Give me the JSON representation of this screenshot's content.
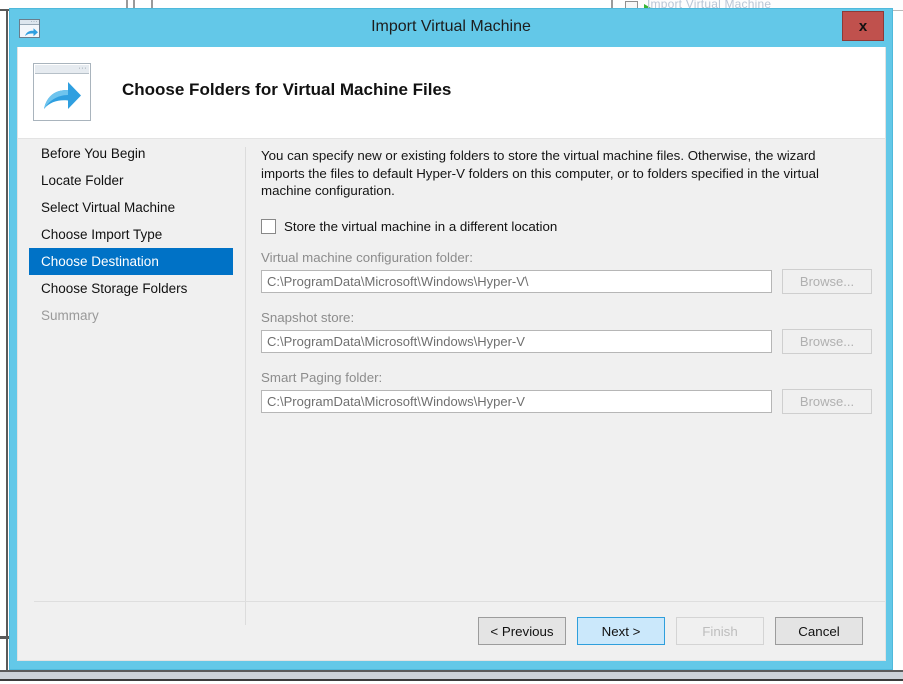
{
  "background": {
    "menu_item_label": "Import Virtual Machine",
    "menu_icon": "green-arrow-icon"
  },
  "window": {
    "title": "Import Virtual Machine",
    "title_icon": "import-vm-icon",
    "close_label": "x",
    "titlebar_color": "#63c8e8",
    "close_color": "#c0514d"
  },
  "header": {
    "icon": "window-arrow-icon",
    "title": "Choose Folders for Virtual Machine Files"
  },
  "nav": {
    "items": [
      {
        "label": "Before You Begin",
        "state": "normal"
      },
      {
        "label": "Locate Folder",
        "state": "normal"
      },
      {
        "label": "Select Virtual Machine",
        "state": "normal"
      },
      {
        "label": "Choose Import Type",
        "state": "normal"
      },
      {
        "label": "Choose Destination",
        "state": "selected"
      },
      {
        "label": "Choose Storage Folders",
        "state": "normal"
      },
      {
        "label": "Summary",
        "state": "disabled"
      }
    ],
    "selected_color": "#0072c6"
  },
  "content": {
    "intro": "You can specify new or existing folders to store the virtual machine files. Otherwise, the wizard imports the files to default Hyper-V folders on this computer, or to folders specified in the virtual machine configuration.",
    "checkbox": {
      "label": "Store the virtual machine in a different location",
      "checked": false
    },
    "fields": [
      {
        "label": "Virtual machine configuration folder:",
        "value": "C:\\ProgramData\\Microsoft\\Windows\\Hyper-V\\",
        "browse_label": "Browse...",
        "enabled": false
      },
      {
        "label": "Snapshot store:",
        "value": "C:\\ProgramData\\Microsoft\\Windows\\Hyper-V",
        "browse_label": "Browse...",
        "enabled": false
      },
      {
        "label": "Smart Paging folder:",
        "value": "C:\\ProgramData\\Microsoft\\Windows\\Hyper-V",
        "browse_label": "Browse...",
        "enabled": false
      }
    ]
  },
  "footer": {
    "previous_label": "< Previous",
    "next_label": "Next >",
    "finish_label": "Finish",
    "cancel_label": "Cancel"
  }
}
